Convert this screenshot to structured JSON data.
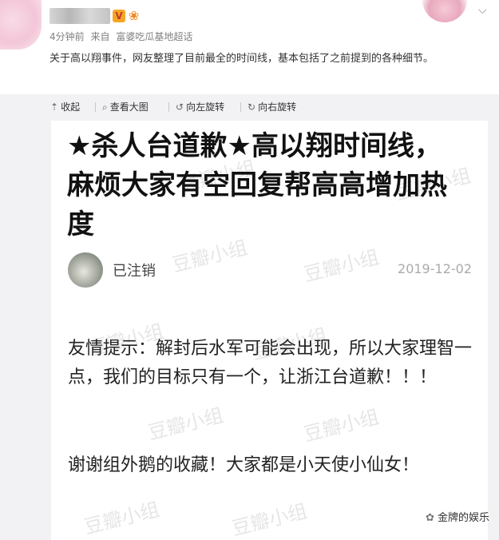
{
  "post": {
    "meta_time": "4分钟前",
    "meta_from": "来自",
    "meta_source": "富婆吃瓜基地超话",
    "text": "关于高以翔事件，网友整理了目前最全的时间线，基本包括了之前提到的各种细节。"
  },
  "toolbar": {
    "collapse": "收起",
    "view_large": "查看大图",
    "rotate_left": "向左旋转",
    "rotate_right": "向右旋转"
  },
  "card": {
    "title": "★杀人台道歉★高以翔时间线，麻烦大家有空回复帮高高增加热度",
    "author": "已注销",
    "date": "2019-12-02",
    "tip": "友情提示：解封后水军可能会出现，所以大家理智一点，我们的目标只有一个，让浙江台道歉！！！",
    "thanks": "谢谢组外鹅的收藏！大家都是小天使小仙女！",
    "watermark": "豆瓣小组"
  },
  "footer": {
    "wechat_account": "金牌的娱乐"
  },
  "icons": {
    "verified": "verified-v-icon",
    "fan": "fan-badge-icon",
    "collapse": "collapse-arrow-icon",
    "search": "search-icon",
    "rotate_left": "rotate-left-icon",
    "rotate_right": "rotate-right-icon",
    "wechat": "wechat-icon"
  }
}
